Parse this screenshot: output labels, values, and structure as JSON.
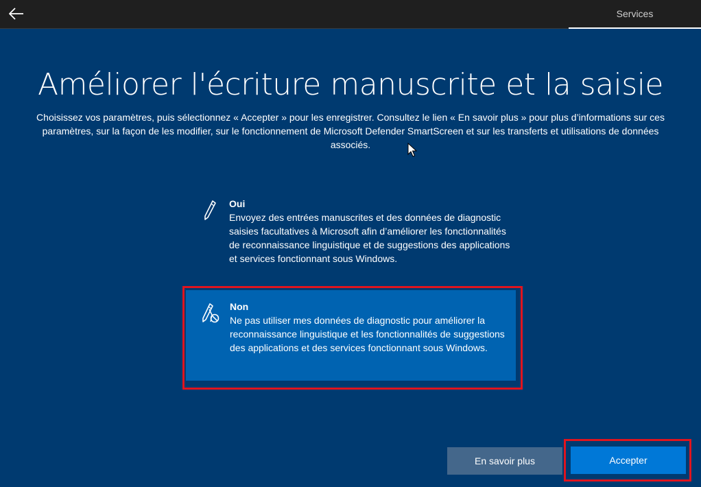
{
  "header": {
    "back_icon": "arrow-left-icon",
    "tab_label": "Services"
  },
  "page": {
    "title": "Améliorer l'écriture manuscrite et la saisie",
    "subtitle": "Choisissez vos paramètres, puis sélectionnez « Accepter » pour les enregistrer. Consultez le lien « En savoir plus » pour plus d’informations sur ces paramètres, sur la façon de les modifier, sur le fonctionnement de Microsoft Defender SmartScreen et sur les transferts et utilisations de données associés."
  },
  "options": [
    {
      "icon": "pen-icon",
      "heading": "Oui",
      "description": "Envoyez des entrées manuscrites et des données de diagnostic saisies facultatives à Microsoft afin d’améliorer les fonctionnalités de reconnaissance linguistique et de suggestions des applications et services fonctionnant sous Windows.",
      "selected": false
    },
    {
      "icon": "pen-blocked-icon",
      "heading": "Non",
      "description": "Ne pas utiliser mes données de diagnostic pour améliorer la reconnaissance linguistique et les fonctionnalités de suggestions des applications et des services fonctionnant sous Windows.",
      "selected": true
    }
  ],
  "buttons": {
    "learn_more": "En savoir plus",
    "accept": "Accepter"
  },
  "colors": {
    "background": "#003a70",
    "selected_option": "#0063b1",
    "accent": "#0078d7",
    "secondary_button": "#44678b",
    "highlight_frame": "#e0141e"
  }
}
